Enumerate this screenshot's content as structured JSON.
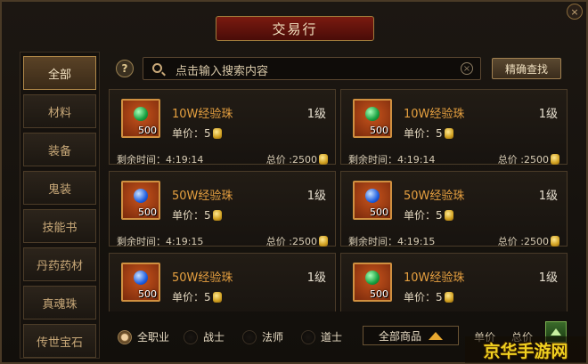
{
  "window": {
    "title": "交易行",
    "close_icon": "×"
  },
  "sidebar": {
    "items": [
      {
        "label": "全部",
        "active": true
      },
      {
        "label": "材料",
        "active": false
      },
      {
        "label": "装备",
        "active": false
      },
      {
        "label": "鬼装",
        "active": false
      },
      {
        "label": "技能书",
        "active": false
      },
      {
        "label": "丹药药材",
        "active": false
      },
      {
        "label": "真魂珠",
        "active": false
      },
      {
        "label": "传世宝石",
        "active": false
      }
    ]
  },
  "search": {
    "help_icon": "?",
    "placeholder": "点击输入搜索内容",
    "clear_icon": "×",
    "precise_button": "精确查找"
  },
  "listings": [
    {
      "name": "10W经验珠",
      "gem": "green",
      "qty": "500",
      "level": "1级",
      "unit_price": "单价：5",
      "time": "剩余时间：4:19:14",
      "total": "总价 :2500"
    },
    {
      "name": "10W经验珠",
      "gem": "green",
      "qty": "500",
      "level": "1级",
      "unit_price": "单价：5",
      "time": "剩余时间：4:19:14",
      "total": "总价 :2500"
    },
    {
      "name": "50W经验珠",
      "gem": "blue",
      "qty": "500",
      "level": "1级",
      "unit_price": "单价：5",
      "time": "剩余时间：4:19:15",
      "total": "总价 :2500"
    },
    {
      "name": "50W经验珠",
      "gem": "blue",
      "qty": "500",
      "level": "1级",
      "unit_price": "单价：5",
      "time": "剩余时间：4:19:15",
      "total": "总价 :2500"
    },
    {
      "name": "50W经验珠",
      "gem": "blue",
      "qty": "500",
      "level": "1级",
      "unit_price": "单价：5",
      "time": "",
      "total": ""
    },
    {
      "name": "10W经验珠",
      "gem": "green",
      "qty": "500",
      "level": "1级",
      "unit_price": "单价：5",
      "time": "",
      "total": ""
    }
  ],
  "filters": {
    "classes": [
      {
        "label": "全职业",
        "checked": true
      },
      {
        "label": "战士",
        "checked": false
      },
      {
        "label": "法师",
        "checked": false
      },
      {
        "label": "道士",
        "checked": false
      }
    ],
    "goods_select": "全部商品",
    "sort_unit_price": "单价",
    "sort_total_price": "总价"
  },
  "watermark": "京华手游网",
  "colors": {
    "accent_gold": "#e6a040",
    "title_red": "#7a1a10",
    "coin_gold": "#d0a020"
  }
}
